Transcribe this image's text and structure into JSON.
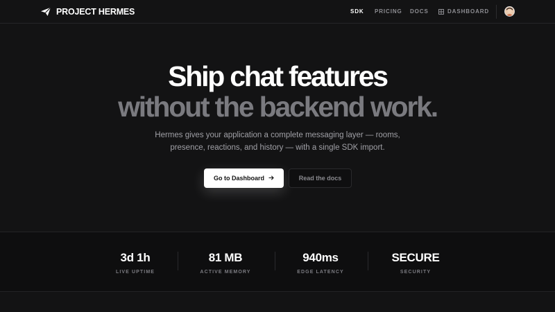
{
  "nav": {
    "brand": {
      "name": "PROJECT HERMES",
      "icon": "paper-plane-icon"
    },
    "links": [
      {
        "label": "SDK",
        "active": true
      },
      {
        "label": "PRICING",
        "active": false
      },
      {
        "label": "DOCS",
        "active": false
      },
      {
        "label": "DASHBOARD",
        "active": false,
        "icon": "grid-icon"
      }
    ],
    "avatar": {
      "icon": "user-avatar"
    }
  },
  "hero": {
    "title_line1": "Ship chat features",
    "title_line2": "without the backend work.",
    "subtitle_line1": "Hermes gives your application a complete messaging layer — rooms,",
    "subtitle_line2": "presence, reactions, and history — with a single SDK import.",
    "primary_button": {
      "label": "Go to Dashboard",
      "icon": "arrow-right-icon"
    },
    "secondary_button": {
      "label": "Read the docs"
    }
  },
  "stats": [
    {
      "value": "3d 1h",
      "label": "LIVE UPTIME"
    },
    {
      "value": "81 MB",
      "label": "ACTIVE MEMORY"
    },
    {
      "value": "940ms",
      "label": "EDGE LATENCY"
    },
    {
      "value": "SECURE",
      "label": "SECURITY"
    }
  ],
  "colors": {
    "background": "#131314",
    "stats_background": "#0e0e0f",
    "text_primary": "#ffffff",
    "text_muted": "#7a7a7f",
    "button_primary_bg": "#ffffff"
  }
}
